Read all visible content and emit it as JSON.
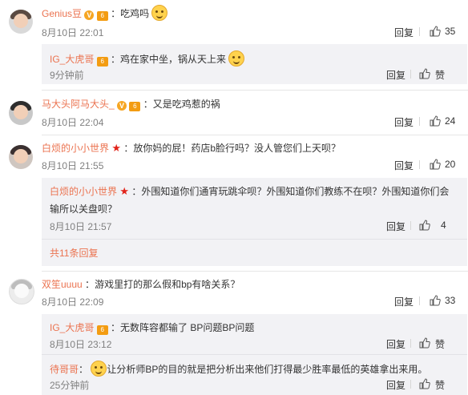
{
  "comments": [
    {
      "user": "Genius豆",
      "sep": "：",
      "text": "吃鸡吗",
      "time": "8月10日 22:01",
      "reply_label": "回复",
      "likes": "35",
      "sub": {
        "user": "IG_大虎哥",
        "sep": "：",
        "text": "鸡在家中坐，锅从天上来",
        "time": "9分钟前",
        "reply_label": "回复",
        "like_label": "赞"
      }
    },
    {
      "user": "马大头阿马大头_",
      "sep": "：",
      "text": "又是吃鸡惹的祸",
      "time": "8月10日 22:04",
      "reply_label": "回复",
      "likes": "24"
    },
    {
      "user": "白烦的小小世界",
      "sep": "：",
      "text": "放你妈的屁！药店b脸行吗？没人管您们上天呗？",
      "time": "8月10日 21:55",
      "reply_label": "回复",
      "likes": "20",
      "sub": {
        "user": "白烦的小小世界",
        "sep": "：",
        "text_line1": "外围知道你们通宵玩跳伞呗？外围知道你们教练不在呗？外围知道你们会",
        "text_line2": "输所以关盘呗？",
        "time": "8月10日 21:57",
        "reply_label": "回复",
        "likes": "4"
      },
      "more": "共11条回复"
    },
    {
      "user": "双笙uuuu",
      "sep": "：",
      "text": "游戏里打的那么假和bp有啥关系？",
      "time": "8月10日 22:09",
      "reply_label": "回复",
      "likes": "33",
      "sub": {
        "user": "IG_大虎哥",
        "sep": "：",
        "text": "无数阵容都输了 BP问题BP问题",
        "time": "8月10日 23:12",
        "reply_label": "回复",
        "like_label": "赞"
      },
      "sub2": {
        "user": "待哥哥",
        "sep": "：",
        "text": "让分析师BP的目的就是把分析出来他们打得最少胜率最低的英雄拿出来用。",
        "time": "25分钟前",
        "reply_label": "回复",
        "like_label": "赞"
      }
    }
  ],
  "badges": {
    "v": "V",
    "level": "6"
  },
  "colors": {
    "username": "#eb7350",
    "reply_bg": "#f2f2f5",
    "muted": "#808080"
  },
  "icons": [
    "avatar",
    "verified-icon",
    "level-icon",
    "star-icon",
    "emoji-icon",
    "thumbs-up-icon"
  ]
}
